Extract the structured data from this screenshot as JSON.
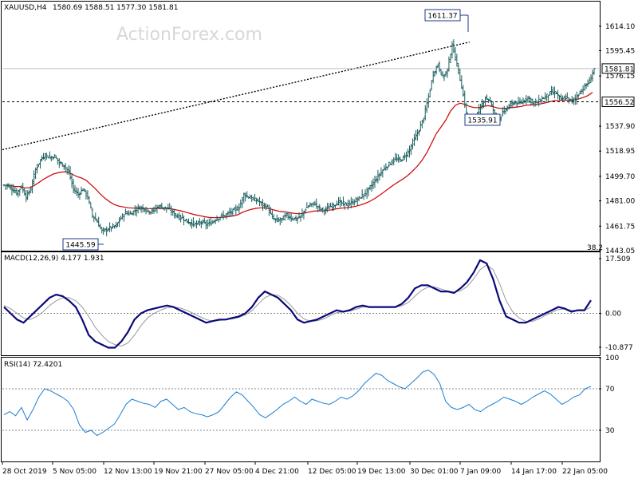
{
  "header": {
    "symbol": "XAUUSD,H4",
    "ohlc": "1580.69 1588.51 1577.30 1581.81",
    "watermark": "ActionForex.com"
  },
  "colors": {
    "bar": "#1b5e5e",
    "ma": "#cc0000",
    "macd": "#0a0a7a",
    "signal": "#999999",
    "dash": "#000000",
    "rsi": "#1a7fd4"
  },
  "chart_data": [
    {
      "type": "candlestick",
      "title": "XAUUSD,H4",
      "ylim": [
        1443.05,
        1632.85
      ],
      "yticks": [
        "1614.10",
        "1595.45",
        "1576.15",
        "1556.52",
        "1537.90",
        "1518.95",
        "1499.70",
        "1481.00",
        "1461.75",
        "1443.05"
      ],
      "price_axis_labels": [
        "1614.10",
        "1595.45",
        "1576.15",
        "1537.90",
        "1518.95",
        "1499.70",
        "1481.00",
        "1461.75",
        "1443.05"
      ],
      "current_price": "1581.81",
      "level_line": "1556.52",
      "series_close": [
        1493,
        1490,
        1487,
        1492,
        1484,
        1490,
        1505,
        1512,
        1516,
        1514,
        1515,
        1510,
        1508,
        1503,
        1490,
        1486,
        1490,
        1484,
        1470,
        1465,
        1458,
        1459,
        1461,
        1462,
        1468,
        1472,
        1471,
        1474,
        1476,
        1475,
        1473,
        1474,
        1477,
        1476,
        1475,
        1472,
        1469,
        1468,
        1465,
        1464,
        1463,
        1465,
        1463,
        1464,
        1467,
        1469,
        1470,
        1472,
        1474,
        1476,
        1486,
        1484,
        1482,
        1481,
        1478,
        1476,
        1468,
        1466,
        1467,
        1470,
        1468,
        1467,
        1469,
        1475,
        1478,
        1479,
        1475,
        1474,
        1476,
        1478,
        1480,
        1479,
        1478,
        1480,
        1482,
        1485,
        1488,
        1493,
        1498,
        1503,
        1507,
        1510,
        1513,
        1512,
        1515,
        1520,
        1528,
        1535,
        1545,
        1560,
        1578,
        1585,
        1575,
        1581,
        1600,
        1585,
        1568,
        1548,
        1542,
        1545,
        1552,
        1560,
        1557,
        1547,
        1544,
        1550,
        1553,
        1556,
        1555,
        1557,
        1560,
        1556,
        1556,
        1559,
        1561,
        1564,
        1563,
        1558,
        1560,
        1557,
        1559,
        1564,
        1568,
        1572,
        1581.81
      ],
      "ma_label": "moving average",
      "annotations": [
        {
          "text": "1611.37",
          "kind": "high"
        },
        {
          "text": "1535.91",
          "kind": "low"
        },
        {
          "text": "1445.59",
          "kind": "low"
        },
        {
          "text": "38.2",
          "kind": "fibonacci"
        }
      ],
      "xticks": [
        "28 Oct 2019",
        "5 Nov 05:00",
        "12 Nov 13:00",
        "19 Nov 21:00",
        "27 Nov 05:00",
        "4 Dec 21:00",
        "12 Dec 05:00",
        "19 Dec 13:00",
        "30 Dec 01:00",
        "7 Jan 09:00",
        "14 Jan 17:00",
        "22 Jan 05:00"
      ]
    },
    {
      "type": "line",
      "title": "MACD(12,26,9) 4.177 1.931",
      "ylim": [
        -10.877,
        17.509
      ],
      "yticks": [
        "17.509",
        "0.00",
        "-10.877"
      ],
      "series": [
        {
          "values": [
            2,
            0,
            -2,
            -3,
            -1,
            1,
            3,
            5,
            6,
            5.5,
            4,
            2,
            -2,
            -7,
            -9,
            -10,
            -11,
            -11,
            -9,
            -6,
            -2,
            0,
            1,
            1.5,
            2,
            2.5,
            2,
            1,
            0,
            -1,
            -2,
            -3,
            -2.5,
            -2,
            -2,
            -1.5,
            -1,
            0,
            2,
            5,
            7,
            6,
            5,
            3,
            1,
            -2,
            -3,
            -2.5,
            -2,
            -1,
            0,
            1,
            0.5,
            1,
            2,
            2.5,
            2,
            2,
            2,
            2,
            2,
            3,
            5,
            8,
            9,
            9,
            8,
            7,
            7,
            6.5,
            8,
            10,
            13,
            17,
            16,
            11,
            4,
            -1,
            -2,
            -3,
            -3,
            -2,
            -1,
            0,
            1,
            2,
            1.5,
            0.5,
            1,
            1,
            4.177
          ]
        },
        {
          "values": [
            2.5,
            1.5,
            0,
            -1.5,
            -2,
            -1,
            0.5,
            2.5,
            4,
            5,
            5,
            4,
            2,
            -1,
            -4.5,
            -7,
            -9,
            -10,
            -10.5,
            -9.5,
            -7,
            -4,
            -1.5,
            0,
            1,
            1.8,
            2,
            1.7,
            1,
            0,
            -1,
            -2,
            -2.5,
            -2.3,
            -2,
            -1.8,
            -1.3,
            -0.5,
            0.8,
            3,
            5,
            6,
            5.8,
            4.5,
            2.5,
            0,
            -1.8,
            -2.6,
            -2.4,
            -1.8,
            -0.8,
            0.2,
            0.5,
            0.7,
            1.3,
            2,
            2.1,
            2,
            2,
            2,
            2,
            2.4,
            3.5,
            5.5,
            7.3,
            8.4,
            8.5,
            7.8,
            7.2,
            6.8,
            7.2,
            8.5,
            11,
            14,
            15.5,
            14,
            9.5,
            4,
            0.5,
            -1.5,
            -2.6,
            -2.6,
            -1.8,
            -0.7,
            0.3,
            1.2,
            1.4,
            1,
            0.9,
            1,
            1.931
          ]
        }
      ]
    },
    {
      "type": "line",
      "title": "RSI(14) 72.4201",
      "ylim": [
        0,
        100
      ],
      "yticks": [
        "100",
        "70",
        "30",
        "0"
      ],
      "series": [
        {
          "values": [
            45,
            48,
            44,
            52,
            40,
            50,
            62,
            70,
            68,
            65,
            62,
            58,
            50,
            35,
            28,
            30,
            25,
            28,
            32,
            36,
            45,
            55,
            60,
            58,
            56,
            55,
            52,
            58,
            60,
            55,
            50,
            52,
            48,
            46,
            45,
            43,
            45,
            48,
            55,
            62,
            67,
            64,
            58,
            52,
            45,
            42,
            46,
            50,
            55,
            58,
            62,
            58,
            55,
            60,
            58,
            56,
            55,
            58,
            62,
            60,
            63,
            68,
            75,
            80,
            85,
            83,
            78,
            75,
            72,
            70,
            75,
            80,
            86,
            88,
            84,
            75,
            58,
            52,
            50,
            52,
            55,
            50,
            48,
            52,
            55,
            58,
            62,
            60,
            58,
            55,
            58,
            62,
            65,
            68,
            65,
            60,
            55,
            58,
            62,
            64,
            70,
            72.4201
          ]
        }
      ]
    }
  ]
}
